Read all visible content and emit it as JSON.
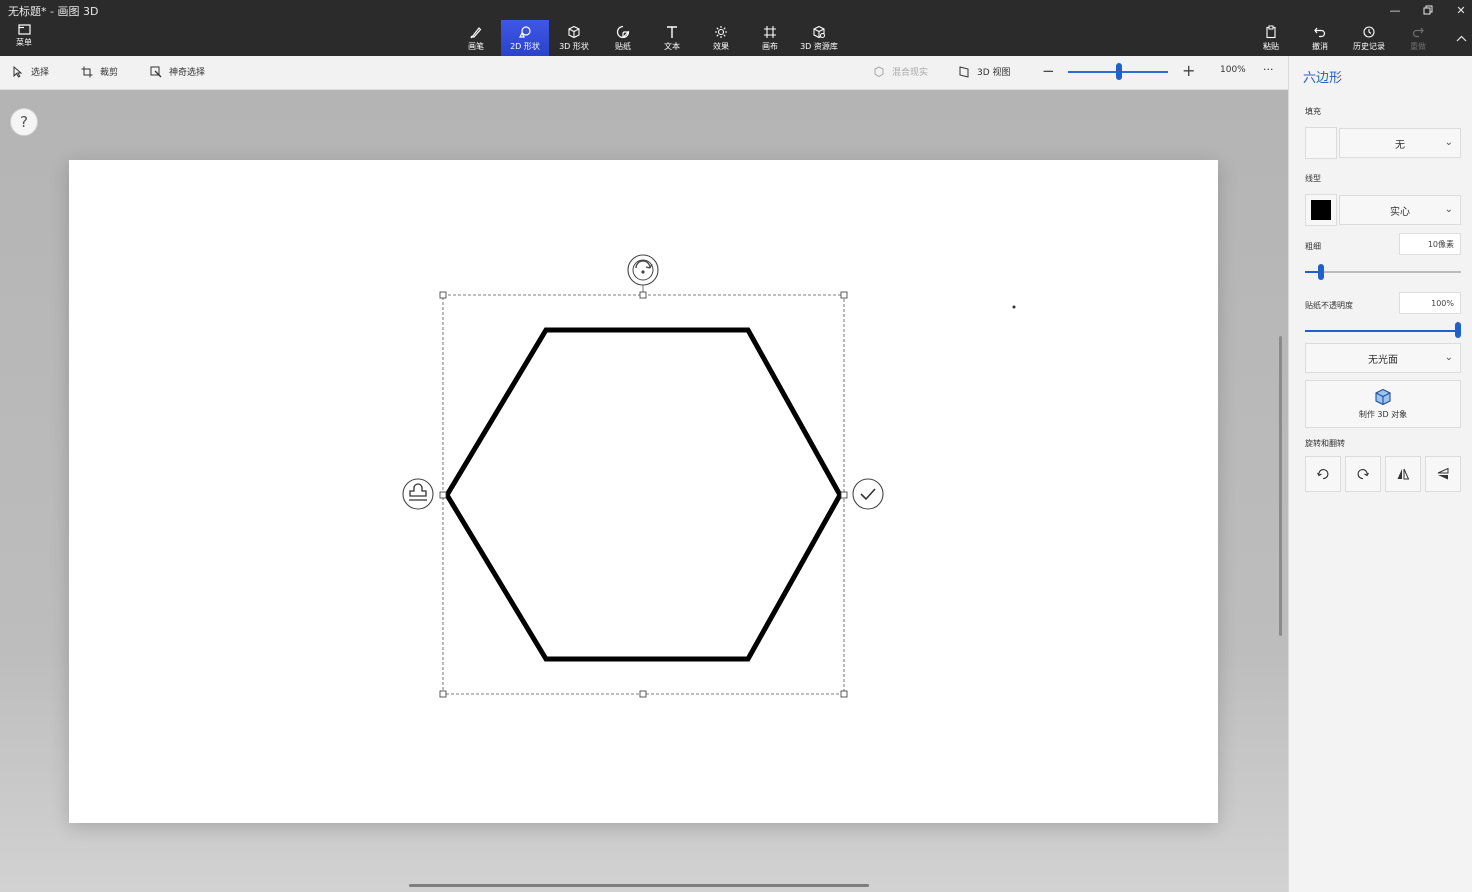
{
  "window": {
    "title": "无标题* - 画图 3D",
    "controls": [
      "minimize-icon",
      "restore-icon",
      "close-icon"
    ]
  },
  "ribbon": {
    "menu_label": "菜单",
    "tabs": [
      {
        "label": "画笔",
        "icon": "brush-icon"
      },
      {
        "label": "2D 形状",
        "icon": "2d-shapes-icon",
        "active": true
      },
      {
        "label": "3D 形状",
        "icon": "3d-shapes-icon"
      },
      {
        "label": "贴纸",
        "icon": "sticker-icon"
      },
      {
        "label": "文本",
        "icon": "text-icon"
      },
      {
        "label": "效果",
        "icon": "effects-icon"
      },
      {
        "label": "画布",
        "icon": "canvas-icon"
      },
      {
        "label": "3D 资源库",
        "icon": "3d-library-icon"
      }
    ],
    "right_actions": [
      {
        "label": "粘贴",
        "icon": "paste-icon"
      },
      {
        "label": "撤消",
        "icon": "undo-icon"
      },
      {
        "label": "历史记录",
        "icon": "history-icon"
      },
      {
        "label": "重做",
        "icon": "redo-icon",
        "disabled": true
      }
    ],
    "accent_color": "#3350e0"
  },
  "toolbar": {
    "select_label": "选择",
    "crop_label": "裁剪",
    "magic_select_label": "神奇选择",
    "mixed_reality_label": "混合现实",
    "view3d_label": "3D 视图",
    "zoom_value": "100%",
    "more_label": "···"
  },
  "workspace": {
    "help_label": "?"
  },
  "panel": {
    "title": "六边形",
    "fill_label": "填充",
    "fill_value": "无",
    "line_label": "线型",
    "line_value": "实心",
    "line_color": "#000000",
    "thickness_label": "粗细",
    "thickness_value": "10像素",
    "thickness_fraction": 0.1,
    "opacity_label": "贴纸不透明度",
    "opacity_value": "100%",
    "opacity_fraction": 1.0,
    "finish_value": "无光面",
    "make3d_label": "制作 3D 对象",
    "rotate_label": "旋转和翻转",
    "accent_color": "#2060c8"
  }
}
